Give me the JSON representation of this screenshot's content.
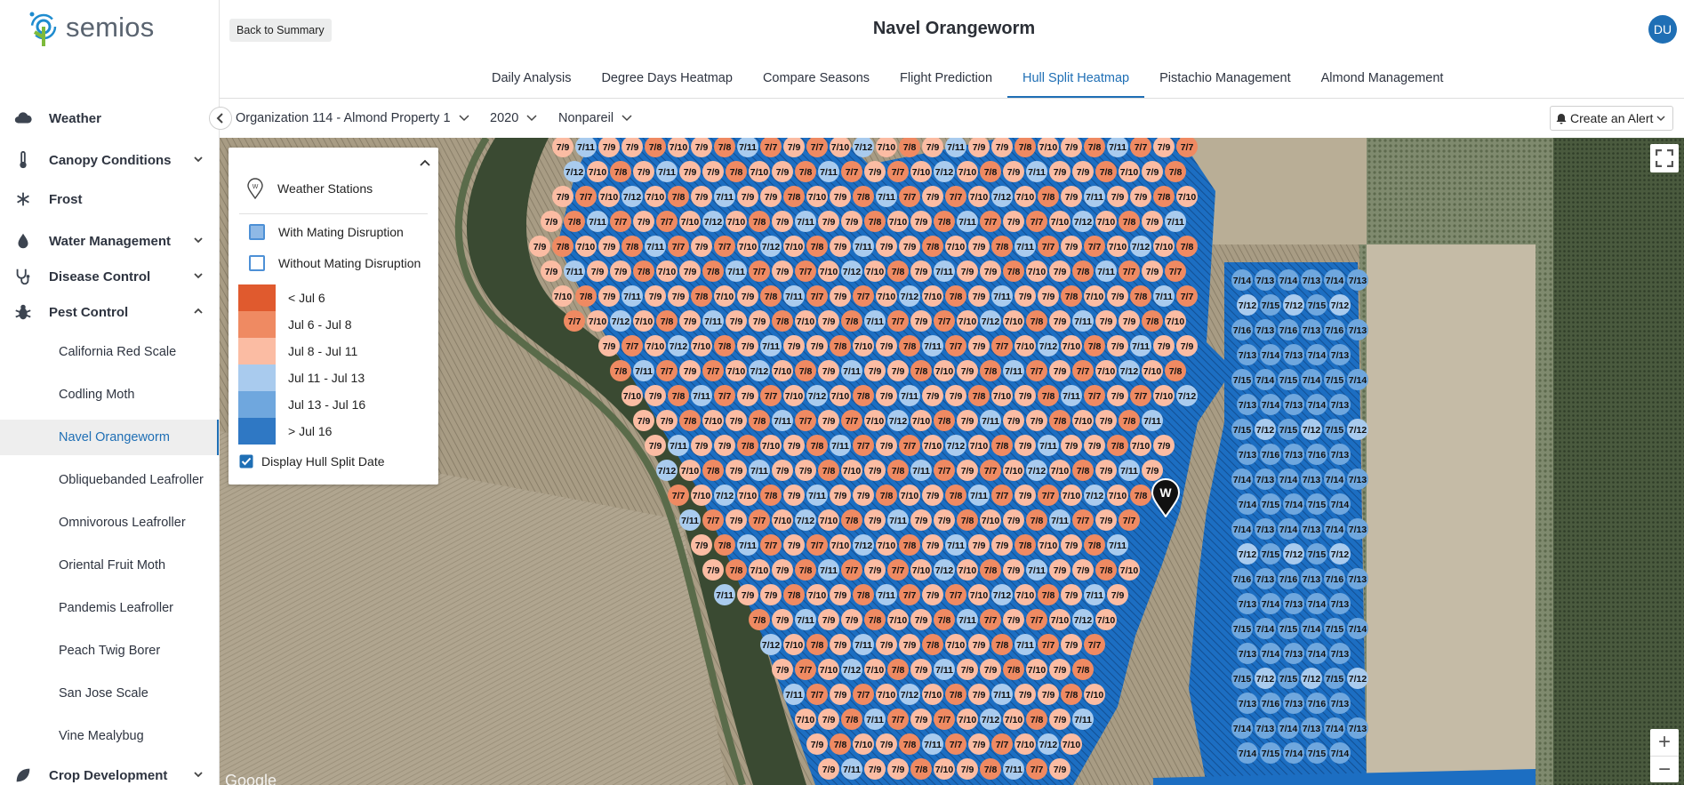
{
  "brand": {
    "name": "semios"
  },
  "sidebar": {
    "items": [
      {
        "label": "Weather",
        "icon": "cloud-icon",
        "expandable": false
      },
      {
        "label": "Canopy Conditions",
        "icon": "thermometer-icon",
        "expandable": true
      },
      {
        "label": "Frost",
        "icon": "snowflake-icon",
        "expandable": false
      },
      {
        "label": "Water Management",
        "icon": "droplet-icon",
        "expandable": true
      },
      {
        "label": "Disease Control",
        "icon": "stethoscope-icon",
        "expandable": true
      },
      {
        "label": "Pest Control",
        "icon": "bug-icon",
        "expandable": true,
        "expanded": true
      },
      {
        "label": "Crop Development",
        "icon": "leaf-icon",
        "expandable": true
      }
    ],
    "pest_control_items": [
      "California Red Scale",
      "Codling Moth",
      "Navel Orangeworm",
      "Obliquebanded Leafroller",
      "Omnivorous Leafroller",
      "Oriental Fruit Moth",
      "Pandemis Leafroller",
      "Peach Twig Borer",
      "San Jose Scale",
      "Vine Mealybug"
    ],
    "active_item": "Navel Orangeworm"
  },
  "header": {
    "back_label": "Back to Summary",
    "title": "Navel Orangeworm",
    "avatar_initials": "DU",
    "tabs": [
      "Daily Analysis",
      "Degree Days Heatmap",
      "Compare Seasons",
      "Flight Prediction",
      "Hull Split Heatmap",
      "Pistachio Management",
      "Almond Management"
    ],
    "active_tab": "Hull Split Heatmap"
  },
  "filters": {
    "organization": "Organization 114 - Almond Property 1",
    "year": "2020",
    "variety": "Nonpareil",
    "alert_label": "Create an Alert"
  },
  "legend": {
    "weather_stations_label": "Weather Stations",
    "station_icon_letter": "W",
    "with_md_label": "With Mating Disruption",
    "without_md_label": "Without Mating Disruption",
    "ranges": [
      {
        "label": "< Jul 6",
        "color": "#e05a2e"
      },
      {
        "label": "Jul 6 - Jul 8",
        "color": "#ef8a62"
      },
      {
        "label": "Jul 8 - Jul 11",
        "color": "#fbbca3"
      },
      {
        "label": "Jul 11 - Jul 13",
        "color": "#a9cbee"
      },
      {
        "label": "Jul 13 - Jul 16",
        "color": "#6fa7de"
      },
      {
        "label": "> Jul 16",
        "color": "#2f78c4"
      }
    ],
    "display_hull_split_label": "Display Hull Split Date",
    "display_hull_split_checked": true
  },
  "map": {
    "attribution": "Google",
    "station_letter": "W",
    "colors": {
      "7/6": "#ef8a62",
      "7/7": "#ef8a62",
      "7/8": "#ef8a62",
      "7/9": "#fbbca3",
      "7/10": "#fbbca3",
      "7/11": "#a9cbee",
      "7/12": "#a9cbee",
      "7/13": "#6fa7de",
      "7/14": "#6fa7de",
      "7/15": "#6fa7de",
      "7/16": "#6fa7de"
    }
  }
}
